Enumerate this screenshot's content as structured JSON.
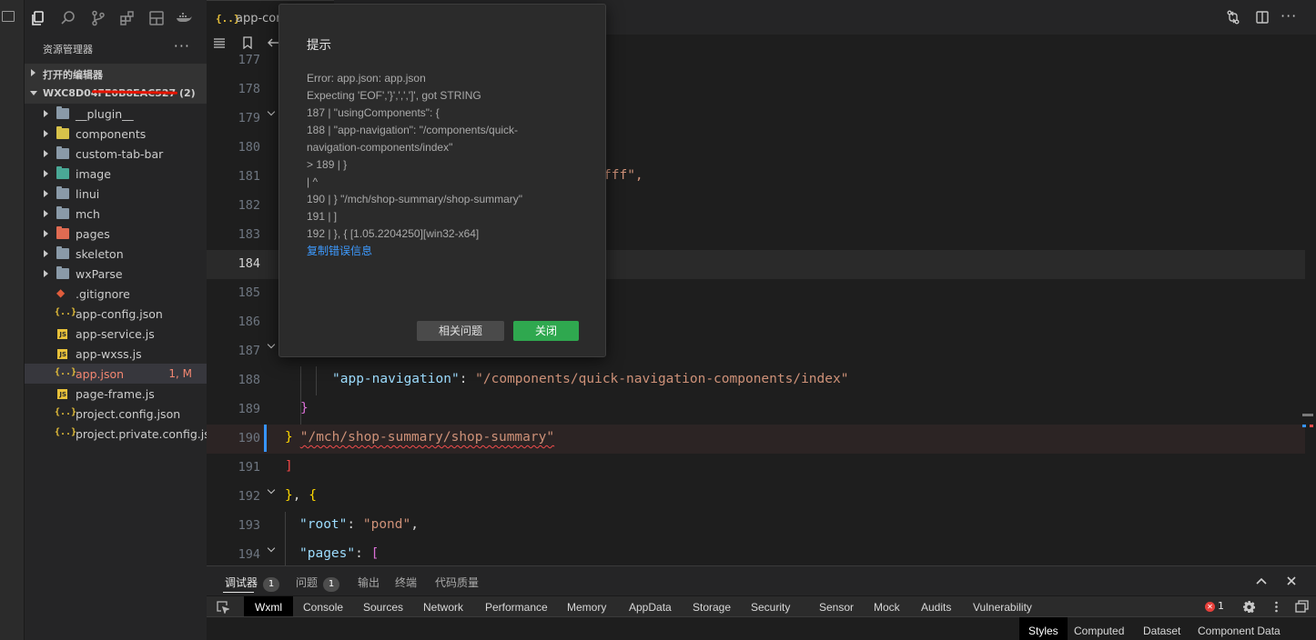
{
  "sidebar": {
    "title": "资源管理器",
    "more": "···",
    "open_editors": "打开的编辑器",
    "project_name": "WXC8D04FE0B8EAC527 (2)",
    "items": [
      {
        "name": "__plugin__",
        "kind": "folder",
        "color": "#8a9aa8"
      },
      {
        "name": "components",
        "kind": "folder",
        "color": "#d8c24a"
      },
      {
        "name": "custom-tab-bar",
        "kind": "folder",
        "color": "#8a9aa8"
      },
      {
        "name": "image",
        "kind": "folder",
        "color": "#4aa896"
      },
      {
        "name": "linui",
        "kind": "folder",
        "color": "#8a9aa8"
      },
      {
        "name": "mch",
        "kind": "folder",
        "color": "#8a9aa8"
      },
      {
        "name": "pages",
        "kind": "folder",
        "color": "#e06b52"
      },
      {
        "name": "skeleton",
        "kind": "folder",
        "color": "#8a9aa8"
      },
      {
        "name": "wxParse",
        "kind": "folder",
        "color": "#8a9aa8"
      },
      {
        "name": ".gitignore",
        "kind": "git"
      },
      {
        "name": "app-config.json",
        "kind": "json"
      },
      {
        "name": "app-service.js",
        "kind": "js"
      },
      {
        "name": "app-wxss.js",
        "kind": "js"
      },
      {
        "name": "app.json",
        "kind": "json",
        "badge": "1, M",
        "selected": true
      },
      {
        "name": "page-frame.js",
        "kind": "js"
      },
      {
        "name": "project.config.json",
        "kind": "json"
      },
      {
        "name": "project.private.config.js...",
        "kind": "json"
      }
    ]
  },
  "editor": {
    "tab_label": "app-con",
    "json_icon": "{..}",
    "lines": [
      {
        "n": "177"
      },
      {
        "n": "178"
      },
      {
        "n": "179"
      },
      {
        "n": "180"
      },
      {
        "n": "181"
      },
      {
        "n": "182"
      },
      {
        "n": "183"
      },
      {
        "n": "184"
      },
      {
        "n": "185"
      },
      {
        "n": "186"
      },
      {
        "n": "187"
      },
      {
        "n": "188"
      },
      {
        "n": "189"
      },
      {
        "n": "190"
      },
      {
        "n": "191"
      },
      {
        "n": "192"
      },
      {
        "n": "193"
      },
      {
        "n": "194"
      }
    ],
    "code": {
      "l181_frag": "fff\",",
      "l188_key": "\"app-navigation\"",
      "l188_colon": ": ",
      "l188_val": "\"/components/quick-navigation-components/index\"",
      "l189": "}",
      "l190_brace": "}",
      "l190_str": "\"/mch/shop-summary/shop-summary\"",
      "l191": "]",
      "l192_a": "}",
      "l192_b": ", ",
      "l192_c": "{",
      "l193_key": "\"root\"",
      "l193_colon": ": ",
      "l193_val": "\"pond\"",
      "l193_comma": ",",
      "l194_key": "\"pages\"",
      "l194_colon": ": ",
      "l194_val": "["
    }
  },
  "modal": {
    "title": "提示",
    "body_lines": [
      "Error: app.json: app.json",
      "Expecting 'EOF','}',',',']', got STRING",
      "187 | \"usingComponents\": {",
      "188 | \"app-navigation\": \"/components/quick-",
      "navigation-components/index\"",
      "> 189 | }",
      "| ^",
      "190 | } \"/mch/shop-summary/shop-summary\"",
      "191 | ]",
      "192 | }, { [1.05.2204250][win32-x64]"
    ],
    "copy_link": "复制错误信息",
    "related_button": "相关问题",
    "close_button": "关闭"
  },
  "panel": {
    "tabs": [
      {
        "label": "调试器",
        "count": "1"
      },
      {
        "label": "问题",
        "count": "1"
      },
      {
        "label": "输出"
      },
      {
        "label": "终端"
      },
      {
        "label": "代码质量"
      }
    ],
    "devtools_tabs": [
      "Wxml",
      "Console",
      "Sources",
      "Network",
      "Performance",
      "Memory",
      "AppData",
      "Storage",
      "Security",
      "Sensor",
      "Mock",
      "Audits",
      "Vulnerability"
    ],
    "error_count": "1",
    "sub_tabs": [
      "Styles",
      "Computed",
      "Dataset",
      "Component Data"
    ]
  },
  "colors": {
    "accent_green": "#2fa84f",
    "link_blue": "#3d9aff",
    "error_red": "#f14c4c",
    "string": "#ce9178",
    "key": "#9cdcfe"
  }
}
